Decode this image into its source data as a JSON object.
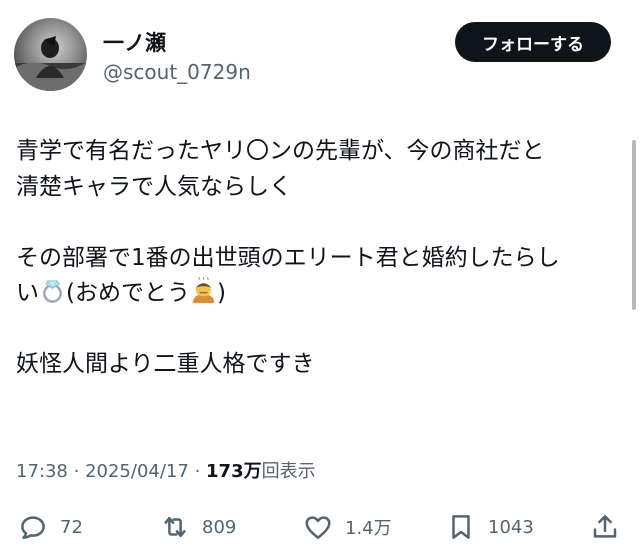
{
  "user": {
    "display_name": "一ノ瀬",
    "handle": "@scout_0729n",
    "follow_label": "フォローする"
  },
  "tweet": {
    "paragraphs": [
      [
        "青学で有名だったヤリ〇ンの先輩が、今の商社だと",
        "清楚キャラで人気ならしく"
      ],
      [
        "その部署で1番の出世頭のエリート君と婚約したらし"
      ],
      [
        "妖怪人間より二重人格ですき"
      ]
    ],
    "line_4_start": "い",
    "line_4_middle": "(おめでとう",
    "line_4_end": ")",
    "emojis": [
      "ring-emoji",
      "person-bowing-emoji"
    ]
  },
  "meta": {
    "time": "17:38",
    "date": "2025/04/17",
    "separator": "·",
    "views_count": "173万",
    "views_label": "回表示"
  },
  "actions": {
    "replies": "72",
    "reposts": "809",
    "likes": "1.4万",
    "bookmarks": "1043"
  },
  "colors": {
    "text": "#0f1419",
    "secondary": "#536471",
    "follow_bg": "#0f1419",
    "follow_text": "#ffffff"
  }
}
